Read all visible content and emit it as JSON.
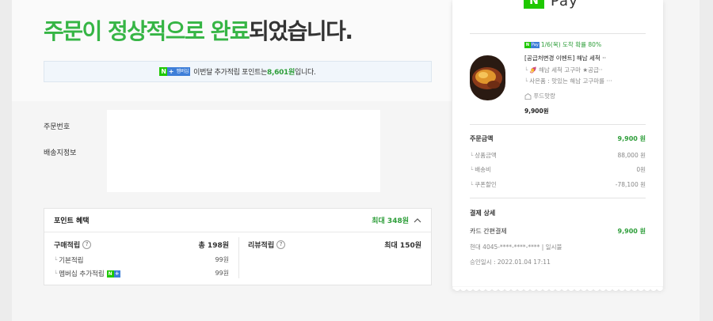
{
  "headline": {
    "green_part": "주문이 정상적으로 완료",
    "dark_part": "되었습니다."
  },
  "point_banner": {
    "badge_n": "N",
    "badge_plus": "+",
    "badge_label": "멤버십",
    "text_before": "이번달 추가적립 포인트는 ",
    "amount": "8,601원",
    "text_after": "입니다."
  },
  "order_info": {
    "order_number_label": "주문번호",
    "delivery_label": "배송지정보"
  },
  "benefits": {
    "title": "포인트 혜택",
    "max_label": "최대 348원",
    "purchase": {
      "label": "구매적립",
      "help": "?",
      "total": "총 198원",
      "items": [
        {
          "label": "기본적립",
          "value": "99원"
        },
        {
          "label": "멤버십 추가적립",
          "value": "99원"
        }
      ]
    },
    "review": {
      "label": "리뷰적립",
      "help": "?",
      "total": "최대 150원"
    }
  },
  "receipt": {
    "logo_n": "N",
    "logo_pay": "Pay",
    "arrival_badge_n": "N",
    "arrival_badge_label": "Pay",
    "arrival_text": "1/6(목) 도착 확률 80%",
    "product_title": "[공급처변경 이벤트] 해남 세척 ··",
    "option1": "🍠 해남 세척 고구마 ★공급··",
    "option2": "사은품 : 맛있는 해남 고구마를 ···",
    "store": "푸드맛랑",
    "product_price": "9,900원",
    "order_amount_label": "주문금액",
    "order_amount_value": "9,900 원",
    "breakdown": [
      {
        "label": "상품금액",
        "value": "88,000 원"
      },
      {
        "label": "배송비",
        "value": "0원"
      },
      {
        "label": "쿠폰할인",
        "value": "-78,100 원"
      }
    ],
    "payment_title": "결제 상세",
    "payment_method": "카드 간편결제",
    "payment_value": "9,900 원",
    "card_info": "현대 4045-****-****-**** | 일시불",
    "approved_at": "승인일시 : 2022.01.04 17:11"
  },
  "colors": {
    "green": "#36b545",
    "npay_green": "#1ec800",
    "membership_blue": "#3d7ed8"
  }
}
